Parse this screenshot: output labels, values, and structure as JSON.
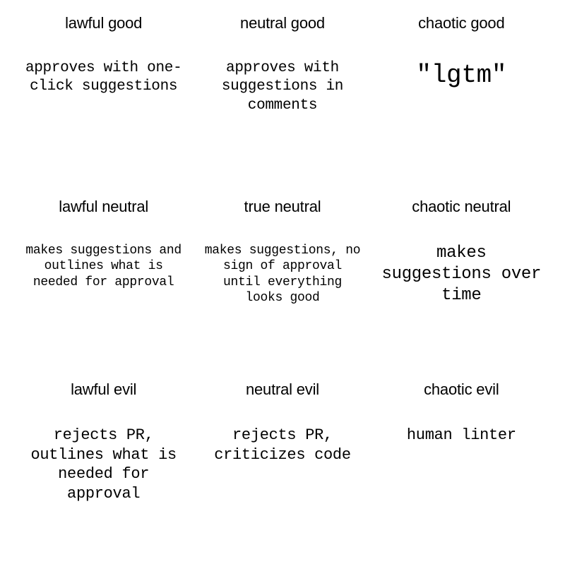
{
  "cells": [
    {
      "label": "lawful good",
      "content": "approves with one-click suggestions",
      "size": "default"
    },
    {
      "label": "neutral good",
      "content": "approves with suggestions in comments",
      "size": "default"
    },
    {
      "label": "chaotic good",
      "content": "\"lgtm\"",
      "size": "large"
    },
    {
      "label": "lawful neutral",
      "content": "makes suggestions and outlines what is needed for approval",
      "size": "small"
    },
    {
      "label": "true neutral",
      "content": "makes suggestions, no sign of approval until everything looks good",
      "size": "small"
    },
    {
      "label": "chaotic neutral",
      "content": "makes suggestions over time",
      "size": "medium-large"
    },
    {
      "label": "lawful evil",
      "content": "rejects PR, outlines what is needed for approval",
      "size": "medium"
    },
    {
      "label": "neutral evil",
      "content": "rejects PR, criticizes code",
      "size": "medium"
    },
    {
      "label": "chaotic evil",
      "content": "human linter",
      "size": "medium"
    }
  ]
}
